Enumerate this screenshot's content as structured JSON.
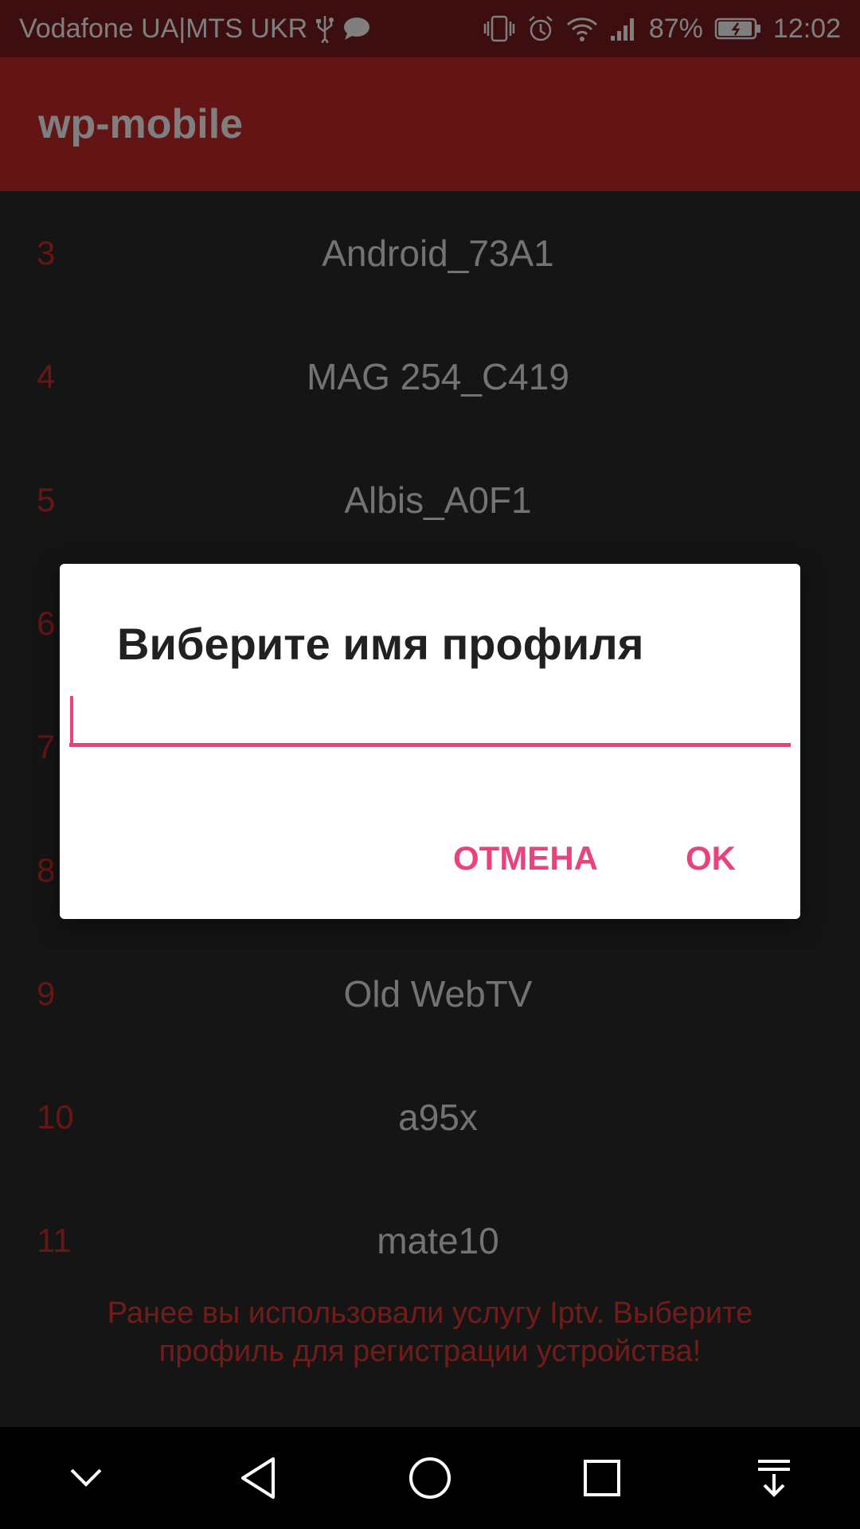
{
  "status_bar": {
    "carrier": "Vodafone UA|MTS UKR",
    "battery": "87%",
    "time": "12:02",
    "icons": [
      "usb-icon",
      "message-icon",
      "vibrate-icon",
      "alarm-icon",
      "wifi-icon",
      "signal-icon",
      "battery-icon"
    ]
  },
  "app_bar": {
    "title": "wp-mobile"
  },
  "list": {
    "items": [
      {
        "num": "3",
        "name": "Android_73A1"
      },
      {
        "num": "4",
        "name": "MAG 254_C419"
      },
      {
        "num": "5",
        "name": "Albis_A0F1"
      },
      {
        "num": "6",
        "name": ""
      },
      {
        "num": "7",
        "name": ""
      },
      {
        "num": "8",
        "name": ""
      },
      {
        "num": "9",
        "name": "Old WebTV"
      },
      {
        "num": "10",
        "name": "a95x"
      },
      {
        "num": "11",
        "name": "mate10"
      }
    ]
  },
  "notice": "Ранее вы использовали услугу Iptv. Выберите профиль для регистрации устройства!",
  "dialog": {
    "title": "Виберите имя профиля",
    "input_value": "",
    "input_placeholder": "",
    "cancel_label": "ОТМЕНА",
    "ok_label": "OK"
  },
  "nav_bar": {
    "icons": [
      "chevron-down-icon",
      "back-icon",
      "home-icon",
      "recents-icon",
      "notifications-pull-icon"
    ]
  },
  "colors": {
    "status_bar": "#7a1c1e",
    "app_bar": "#c62828",
    "accent": "#e8437e",
    "number": "#d12b2b"
  }
}
